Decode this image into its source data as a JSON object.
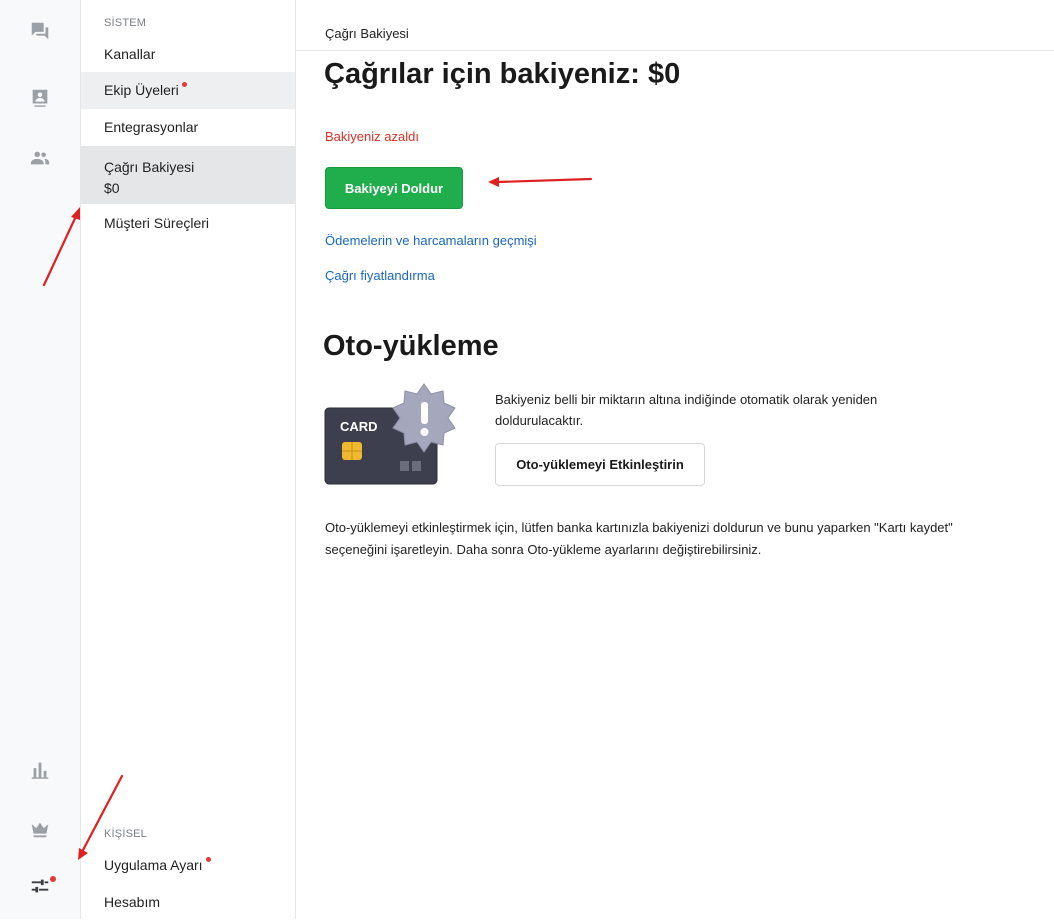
{
  "rail": {
    "icons": [
      "conversations-icon",
      "contacts-card-icon",
      "team-icon",
      "analytics-icon",
      "crown-icon",
      "settings-sliders-icon"
    ]
  },
  "sidebar": {
    "system_label": "SİSTEM",
    "items": [
      {
        "label": "Kanallar"
      },
      {
        "label": "Ekip Üyeleri"
      },
      {
        "label": "Entegrasyonlar"
      },
      {
        "label": "Çağrı Bakiyesi",
        "sub": "$0"
      },
      {
        "label": "Müşteri Süreçleri"
      }
    ],
    "personal_label": "KİŞİSEL",
    "personal_items": [
      {
        "label": "Uygulama Ayarı"
      },
      {
        "label": "Hesabım"
      }
    ]
  },
  "main": {
    "breadcrumb": "Çağrı Bakiyesi",
    "title": "Çağrılar için bakiyeniz: $0",
    "warning": "Bakiyeniz azaldı",
    "topup_button": "Bakiyeyi Doldur",
    "history_link": "Ödemelerin ve harcamaların geçmişi",
    "pricing_link": "Çağrı fiyatlandırma",
    "autoload_title": "Oto-yükleme",
    "card_label": "CARD",
    "autoload_desc": "Bakiyeniz belli bir miktarın altına indiğinde otomatik olarak yeniden doldurulacaktır.",
    "autoload_button": "Oto-yüklemeyi Etkinleştirin",
    "note": "Oto-yüklemeyi etkinleştirmek için, lütfen banka kartınızla bakiyenizi doldurun ve bunu yaparken \"Kartı kaydet\" seçeneğini işaretleyin. Daha sonra Oto-yükleme ayarlarını değiştirebilirsiniz."
  },
  "colors": {
    "accent_green": "#1fae4b",
    "warning_red": "#d93025",
    "link_blue": "#1a66c2",
    "notification_dot": "#e53935"
  }
}
